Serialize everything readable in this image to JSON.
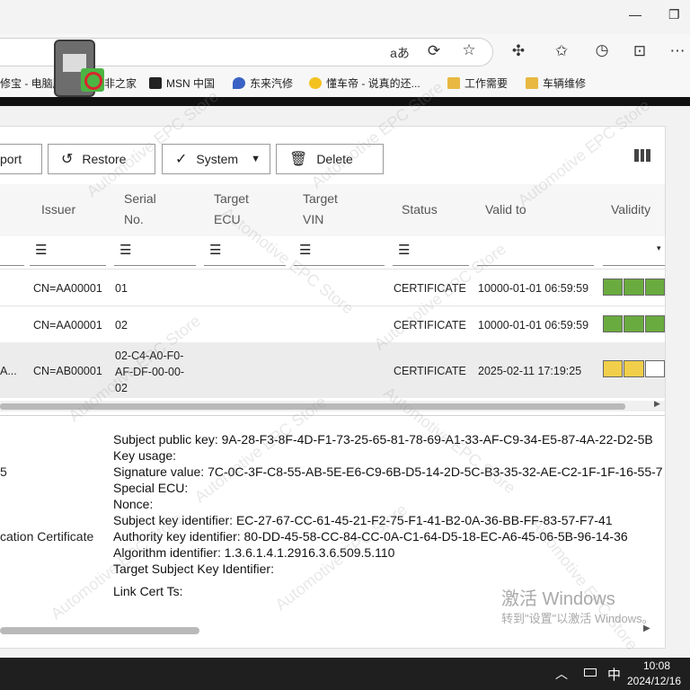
{
  "browser": {
    "min_label": "—",
    "restore_label": "❐",
    "read_aloud_label": "aあ",
    "favorites": [
      {
        "label": "修宝 - 电脑版"
      },
      {
        "label": "非之家"
      },
      {
        "label": "MSN 中国"
      },
      {
        "label": "东来汽修"
      },
      {
        "label": "懂车帝 - 说真的还..."
      },
      {
        "label": "工作需要"
      },
      {
        "label": "车辆维修"
      }
    ]
  },
  "toolbar": {
    "import_label": "port",
    "restore_label": "Restore",
    "system_label": "System",
    "delete_label": "Delete"
  },
  "table": {
    "headers": {
      "issuer": "Issuer",
      "serial_l1": "Serial",
      "serial_l2": "No.",
      "ecu_l1": "Target",
      "ecu_l2": "ECU",
      "vin_l1": "Target",
      "vin_l2": "VIN",
      "status": "Status",
      "valid_to": "Valid to",
      "validity": "Validity"
    },
    "rows": [
      {
        "first": "",
        "issuer": "CN=AA00001",
        "serial": [
          "01"
        ],
        "status": "CERTIFICATE",
        "valid_to": "10000-01-01 06:59:59",
        "validity": "green"
      },
      {
        "first": "",
        "issuer": "CN=AA00001",
        "serial": [
          "02"
        ],
        "status": "CERTIFICATE",
        "valid_to": "10000-01-01 06:59:59",
        "validity": "green"
      },
      {
        "first": "A...",
        "issuer": "CN=AB00001",
        "serial": [
          "02-C4-A0-F0-",
          "AF-DF-00-00-",
          "02"
        ],
        "status": "CERTIFICATE",
        "valid_to": "2025-02-11 17:19:25",
        "validity": "yellow"
      }
    ]
  },
  "details": {
    "left_5": "5",
    "left_cert": "cation Certificate",
    "subject_public_key": "Subject public key: 9A-28-F3-8F-4D-F1-73-25-65-81-78-69-A1-33-AF-C9-34-E5-87-4A-22-D2-5B",
    "key_usage": "Key usage:",
    "signature_value": "Signature value: 7C-0C-3F-C8-55-AB-5E-E6-C9-6B-D5-14-2D-5C-B3-35-32-AE-C2-1F-1F-16-55-7",
    "special_ecu": "Special ECU:",
    "nonce": "Nonce:",
    "subject_key_id": "Subject key identifier: EC-27-67-CC-61-45-21-F2-75-F1-41-B2-0A-36-BB-FF-83-57-F7-41",
    "authority_key_id": "Authority key identifier: 80-DD-45-58-CC-84-CC-0A-C1-64-D5-18-EC-A6-45-06-5B-96-14-36",
    "algorithm_id": "Algorithm identifier: 1.3.6.1.4.1.2916.3.6.509.5.110",
    "target_subject_key_id": "Target Subject Key Identifier:",
    "link_cert_ts": "Link Cert Ts:"
  },
  "activation": {
    "title": "激活 Windows",
    "subtitle": "转到\"设置\"以激活 Windows。"
  },
  "watermark": "Automotive EPC Store",
  "taskbar": {
    "ime": "中",
    "time": "10:08",
    "date": "2024/12/16"
  },
  "colors": {
    "valid_green": "#6aab3f",
    "valid_yellow": "#f2cf4a",
    "taskbar": "#1f1f1f"
  }
}
